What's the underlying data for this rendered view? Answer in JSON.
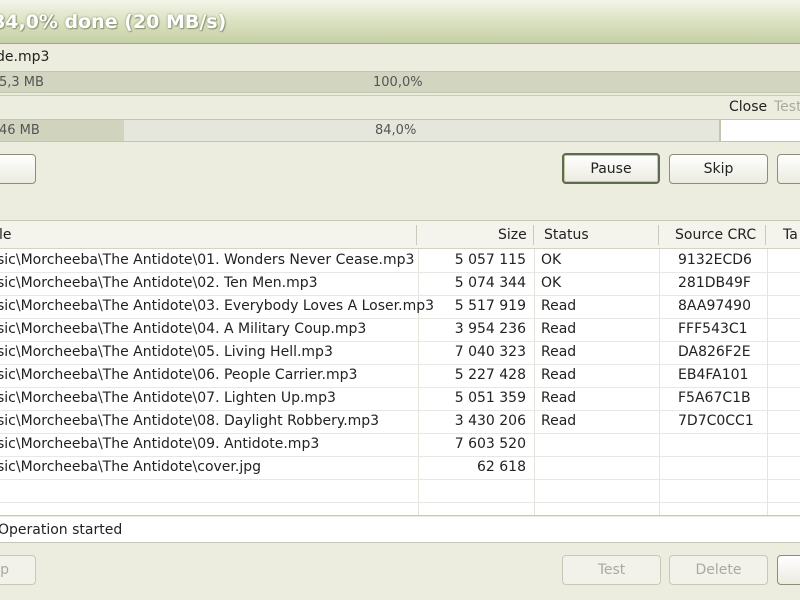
{
  "window": {
    "title": "84,0% done (20 MB/s)"
  },
  "current_file": {
    "name": "de.mp3",
    "size": "5,3 MB",
    "percent": "100,0%",
    "progress_fraction": 1.0
  },
  "total": {
    "size": "46 MB",
    "percent": "84,0%",
    "progress_fraction": 0.84
  },
  "options": {
    "close_label": "Close",
    "test_label": "Test"
  },
  "buttons": {
    "pause": "Pause",
    "skip": "Skip"
  },
  "table": {
    "columns": [
      "le",
      "Size",
      "Status",
      "Source CRC",
      "Ta"
    ],
    "rows": [
      {
        "file": "sic\\Morcheeba\\The Antidote\\01. Wonders Never Cease.mp3",
        "size": "5 057 115",
        "status": "OK",
        "crc": "9132ECD6"
      },
      {
        "file": "sic\\Morcheeba\\The Antidote\\02. Ten Men.mp3",
        "size": "5 074 344",
        "status": "OK",
        "crc": "281DB49F"
      },
      {
        "file": "sic\\Morcheeba\\The Antidote\\03. Everybody Loves A Loser.mp3",
        "size": "5 517 919",
        "status": "Read",
        "crc": "8AA97490"
      },
      {
        "file": "sic\\Morcheeba\\The Antidote\\04. A Military Coup.mp3",
        "size": "3 954 236",
        "status": "Read",
        "crc": "FFF543C1"
      },
      {
        "file": "sic\\Morcheeba\\The Antidote\\05. Living Hell.mp3",
        "size": "7 040 323",
        "status": "Read",
        "crc": "DA826F2E"
      },
      {
        "file": "sic\\Morcheeba\\The Antidote\\06. People Carrier.mp3",
        "size": "5 227 428",
        "status": "Read",
        "crc": "EB4FA101"
      },
      {
        "file": "sic\\Morcheeba\\The Antidote\\07. Lighten Up.mp3",
        "size": "5 051 359",
        "status": "Read",
        "crc": "F5A67C1B"
      },
      {
        "file": "sic\\Morcheeba\\The Antidote\\08. Daylight Robbery.mp3",
        "size": "3 430 206",
        "status": "Read",
        "crc": "7D7C0CC1"
      },
      {
        "file": "sic\\Morcheeba\\The Antidote\\09. Antidote.mp3",
        "size": "7 603 520",
        "status": "",
        "crc": ""
      },
      {
        "file": "sic\\Morcheeba\\The Antidote\\cover.jpg",
        "size": "62 618",
        "status": "",
        "crc": ""
      }
    ]
  },
  "status": {
    "message": "Operation started"
  },
  "bottom_buttons": {
    "left_partial": "p",
    "test": "Test",
    "delete": "Delete"
  }
}
